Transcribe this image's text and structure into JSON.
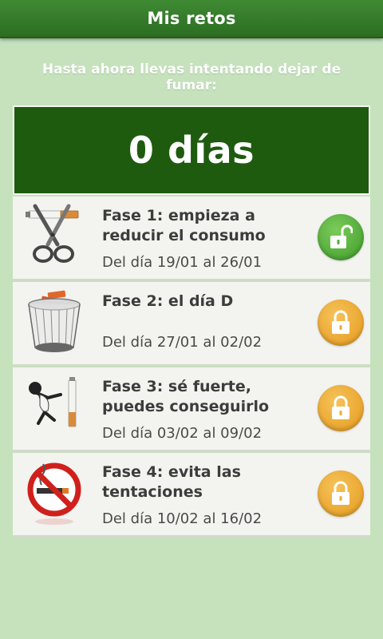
{
  "header": {
    "title": "Mis retos"
  },
  "intro": {
    "text": "Hasta ahora llevas intentando dejar de fumar:"
  },
  "counter": {
    "value": "0 días"
  },
  "phases": [
    {
      "name": "Fase 1: empieza a reducir el consumo",
      "dates": "Del día 19/01 al 26/01",
      "icon": "scissors-cigarette-icon",
      "status": "unlocked",
      "status_color": "#4fae35"
    },
    {
      "name": "Fase 2: el día D",
      "dates": "Del día 27/01 al 02/02",
      "icon": "wastebasket-icon",
      "status": "locked",
      "status_color": "#eeaa30"
    },
    {
      "name": "Fase 3: sé fuerte, puedes conseguirlo",
      "dates": "Del día 03/02 al 09/02",
      "icon": "karate-cigarette-icon",
      "status": "locked",
      "status_color": "#eeaa30"
    },
    {
      "name": "Fase 4: evita las tentaciones",
      "dates": "Del día 10/02 al 16/02",
      "icon": "no-smoking-icon",
      "status": "locked",
      "status_color": "#eeaa30"
    }
  ],
  "colors": {
    "background": "#c6e2bd",
    "header": "#2f7526",
    "counter_bg": "#1e5b0f",
    "unlocked": "#4fae35",
    "locked": "#eeaa30"
  }
}
